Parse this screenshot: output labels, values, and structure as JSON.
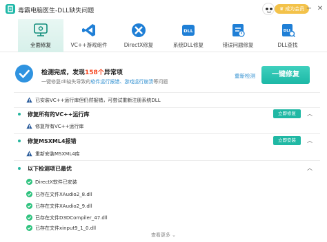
{
  "app": {
    "title": "毒霸电脑医生-DLL缺失问题",
    "member_label": "成为会员"
  },
  "colors": {
    "accent": "#20b8a4",
    "warn": "#f5421c",
    "link": "#2f8fd0",
    "ok": "#2ec27e"
  },
  "tabs": [
    {
      "label": "全面修复",
      "icon": "monitor-icon",
      "active": true
    },
    {
      "label": "VC++游戏组件",
      "icon": "visual-studio-icon",
      "active": false
    },
    {
      "label": "DirectX修复",
      "icon": "directx-icon",
      "active": false
    },
    {
      "label": "系统DLL修复",
      "icon": "dll-icon",
      "active": false
    },
    {
      "label": "错误问题修复",
      "icon": "error-repair-icon",
      "active": false
    },
    {
      "label": "DLL查找",
      "icon": "dll-search-icon",
      "active": false
    }
  ],
  "summary": {
    "title_pre": "检测完成，发现",
    "count": "158个",
    "title_post": "异常项",
    "sub_pre": "一键修复dll缺失导致的",
    "sub_blue": "软件运行报错、游戏运行崩溃",
    "sub_post": "等问题",
    "rescan": "重新检测",
    "fix_all": "一键修复"
  },
  "top_notice": "已安装VC++运行库但仍然报错，可尝试重新注册系统DLL",
  "sections": [
    {
      "title": "修复所有的VC++运行库",
      "action": "立即修复",
      "items": [
        {
          "status": "warn",
          "text": "修复所有VC++运行库"
        }
      ]
    },
    {
      "title": "修复MSXML4报错",
      "action": "立即安装",
      "items": [
        {
          "status": "warn",
          "text": "重新安装MSXML4库"
        }
      ]
    },
    {
      "title": "以下检测项已最优",
      "action": "",
      "items": [
        {
          "status": "ok",
          "text": "DirectX软件已安装"
        },
        {
          "status": "ok",
          "text": "已存在文件XAudio2_8.dll"
        },
        {
          "status": "ok",
          "text": "已存在文件XAudio2_9.dll"
        },
        {
          "status": "ok",
          "text": "已存在文件D3DCompiler_47.dll"
        },
        {
          "status": "ok",
          "text": "已存在文件xinput9_1_0.dll"
        }
      ]
    }
  ],
  "footer": {
    "more": "查看更多"
  }
}
